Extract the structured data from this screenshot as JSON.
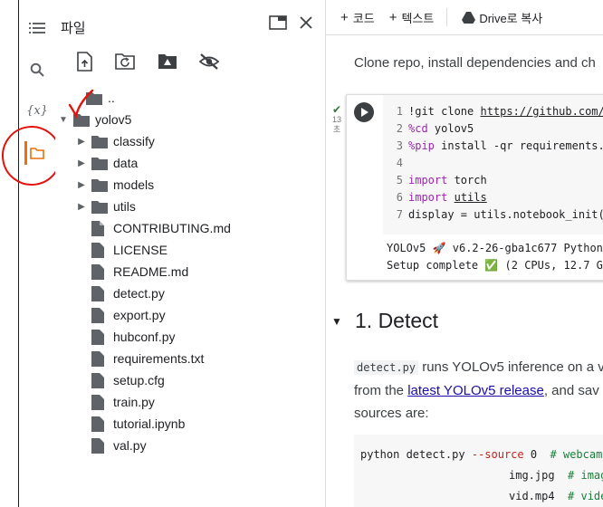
{
  "sidebar_rail": {
    "items": [
      {
        "name": "table-of-contents",
        "icon": "list-icon"
      },
      {
        "name": "search",
        "icon": "search-icon"
      },
      {
        "name": "variables",
        "icon": "variables-icon",
        "label": "{x}"
      },
      {
        "name": "files",
        "icon": "folder-icon",
        "active": true
      }
    ]
  },
  "files_panel": {
    "title": "파일",
    "toolbar": [
      "upload-file-icon",
      "refresh-folder-icon",
      "mount-drive-icon",
      "hide-files-icon"
    ],
    "tree": [
      {
        "label": "..",
        "type": "parent",
        "depth": 0
      },
      {
        "label": "yolov5",
        "type": "folder",
        "expanded": true,
        "depth": 0
      },
      {
        "label": "classify",
        "type": "folder",
        "expanded": false,
        "depth": 1
      },
      {
        "label": "data",
        "type": "folder",
        "expanded": false,
        "depth": 1
      },
      {
        "label": "models",
        "type": "folder",
        "expanded": false,
        "depth": 1
      },
      {
        "label": "utils",
        "type": "folder",
        "expanded": false,
        "depth": 1
      },
      {
        "label": "CONTRIBUTING.md",
        "type": "file",
        "depth": 1
      },
      {
        "label": "LICENSE",
        "type": "file",
        "depth": 1
      },
      {
        "label": "README.md",
        "type": "file",
        "depth": 1
      },
      {
        "label": "detect.py",
        "type": "file",
        "depth": 1
      },
      {
        "label": "export.py",
        "type": "file",
        "depth": 1
      },
      {
        "label": "hubconf.py",
        "type": "file",
        "depth": 1
      },
      {
        "label": "requirements.txt",
        "type": "file",
        "depth": 1
      },
      {
        "label": "setup.cfg",
        "type": "file",
        "depth": 1
      },
      {
        "label": "train.py",
        "type": "file",
        "depth": 1
      },
      {
        "label": "tutorial.ipynb",
        "type": "file",
        "depth": 1
      },
      {
        "label": "val.py",
        "type": "file",
        "depth": 1
      }
    ]
  },
  "notebook": {
    "toolbar": {
      "add_code": "코드",
      "add_text": "텍스트",
      "copy_to_drive": "Drive로 복사"
    },
    "intro_text": "Clone repo, install dependencies and ch",
    "cell_status": {
      "time_value": "13",
      "time_unit": "초"
    },
    "code_lines": [
      {
        "n": "1",
        "parts": [
          {
            "t": "!git clone "
          },
          {
            "t": "https://github.com/u",
            "c": "url"
          }
        ]
      },
      {
        "n": "2",
        "parts": [
          {
            "t": "%cd",
            "c": "kw"
          },
          {
            "t": " yolov5"
          }
        ]
      },
      {
        "n": "3",
        "parts": [
          {
            "t": "%pip",
            "c": "kw"
          },
          {
            "t": " install -qr requirements.t"
          }
        ]
      },
      {
        "n": "4",
        "parts": []
      },
      {
        "n": "5",
        "parts": [
          {
            "t": "import",
            "c": "kw"
          },
          {
            "t": " torch"
          }
        ]
      },
      {
        "n": "6",
        "parts": [
          {
            "t": "import",
            "c": "kw"
          },
          {
            "t": " "
          },
          {
            "t": "utils",
            "c": "url"
          }
        ]
      },
      {
        "n": "7",
        "parts": [
          {
            "t": "display = utils.notebook_init()"
          }
        ]
      }
    ],
    "output_lines": [
      "YOLOv5 🚀 v6.2-26-gba1c677 Python-",
      "Setup complete ✅ (2 CPUs, 12.7 GB"
    ],
    "section_title": "1. Detect",
    "para": {
      "code": "detect.py",
      "line1_rest": " runs YOLOv5 inference on a v",
      "line2_pre": "from the ",
      "line2_link": "latest YOLOv5 release",
      "line2_post": ", and sav",
      "line3": "sources are:"
    },
    "codeblock": {
      "line1_cmd": "python detect.py ",
      "line1_opt": "--source",
      "line1_val": " 0  ",
      "line1_cm": "# webcam",
      "line2_val": "img.jpg  ",
      "line2_cm": "# image",
      "line3_val": "vid.mp4  ",
      "line3_cm": "# video"
    }
  },
  "colors": {
    "accent_orange": "#e8710a",
    "annotation_red": "#e3120b",
    "keyword_purple": "#9c27b0"
  }
}
